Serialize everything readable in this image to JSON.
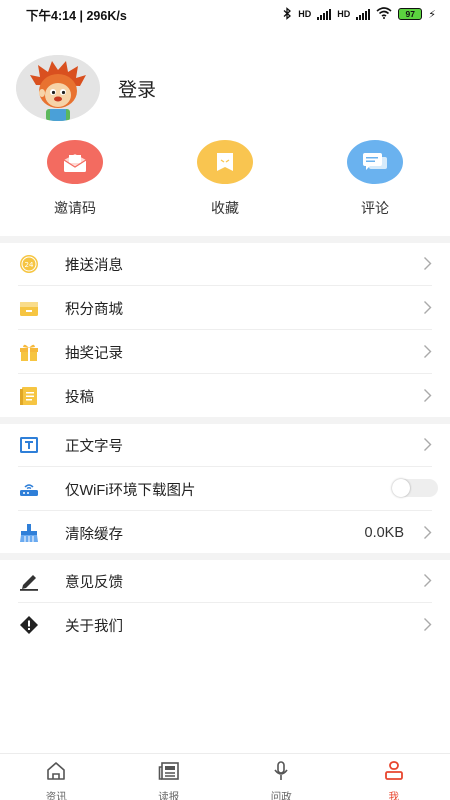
{
  "status_bar": {
    "time_speed": "下午4:14 | 296K/s",
    "hd1": "HD",
    "hd2": "HD",
    "battery": "97"
  },
  "profile": {
    "login_label": "登录"
  },
  "quick_actions": [
    {
      "label": "邀请码",
      "color": "#f36b60",
      "icon": "mail-icon"
    },
    {
      "label": "收藏",
      "color": "#f9c550",
      "icon": "bookmark-icon"
    },
    {
      "label": "评论",
      "color": "#6ab2ef",
      "icon": "chat-icon"
    }
  ],
  "menu_group1": [
    {
      "label": "推送消息",
      "icon": "push-clock-icon"
    },
    {
      "label": "积分商城",
      "icon": "shop-icon"
    },
    {
      "label": "抽奖记录",
      "icon": "gift-icon"
    },
    {
      "label": "投稿",
      "icon": "document-icon"
    }
  ],
  "menu_group2": [
    {
      "label": "正文字号",
      "icon": "font-size-icon"
    },
    {
      "label": "仅WiFi环境下载图片",
      "icon": "wifi-router-icon",
      "toggle_on": false
    },
    {
      "label": "清除缓存",
      "icon": "broom-icon",
      "value": "0.0KB"
    }
  ],
  "menu_group3": [
    {
      "label": "意见反馈",
      "icon": "pencil-icon"
    },
    {
      "label": "关于我们",
      "icon": "info-diamond-icon"
    }
  ],
  "bottom_nav": [
    {
      "label": "资讯",
      "icon": "home-icon",
      "active": false
    },
    {
      "label": "读报",
      "icon": "newspaper-icon",
      "active": false
    },
    {
      "label": "问政",
      "icon": "microphone-icon",
      "active": false
    },
    {
      "label": "我",
      "icon": "user-icon",
      "active": true
    }
  ],
  "colors": {
    "accent": "#e8452e",
    "divider": "#f3f3f3"
  }
}
